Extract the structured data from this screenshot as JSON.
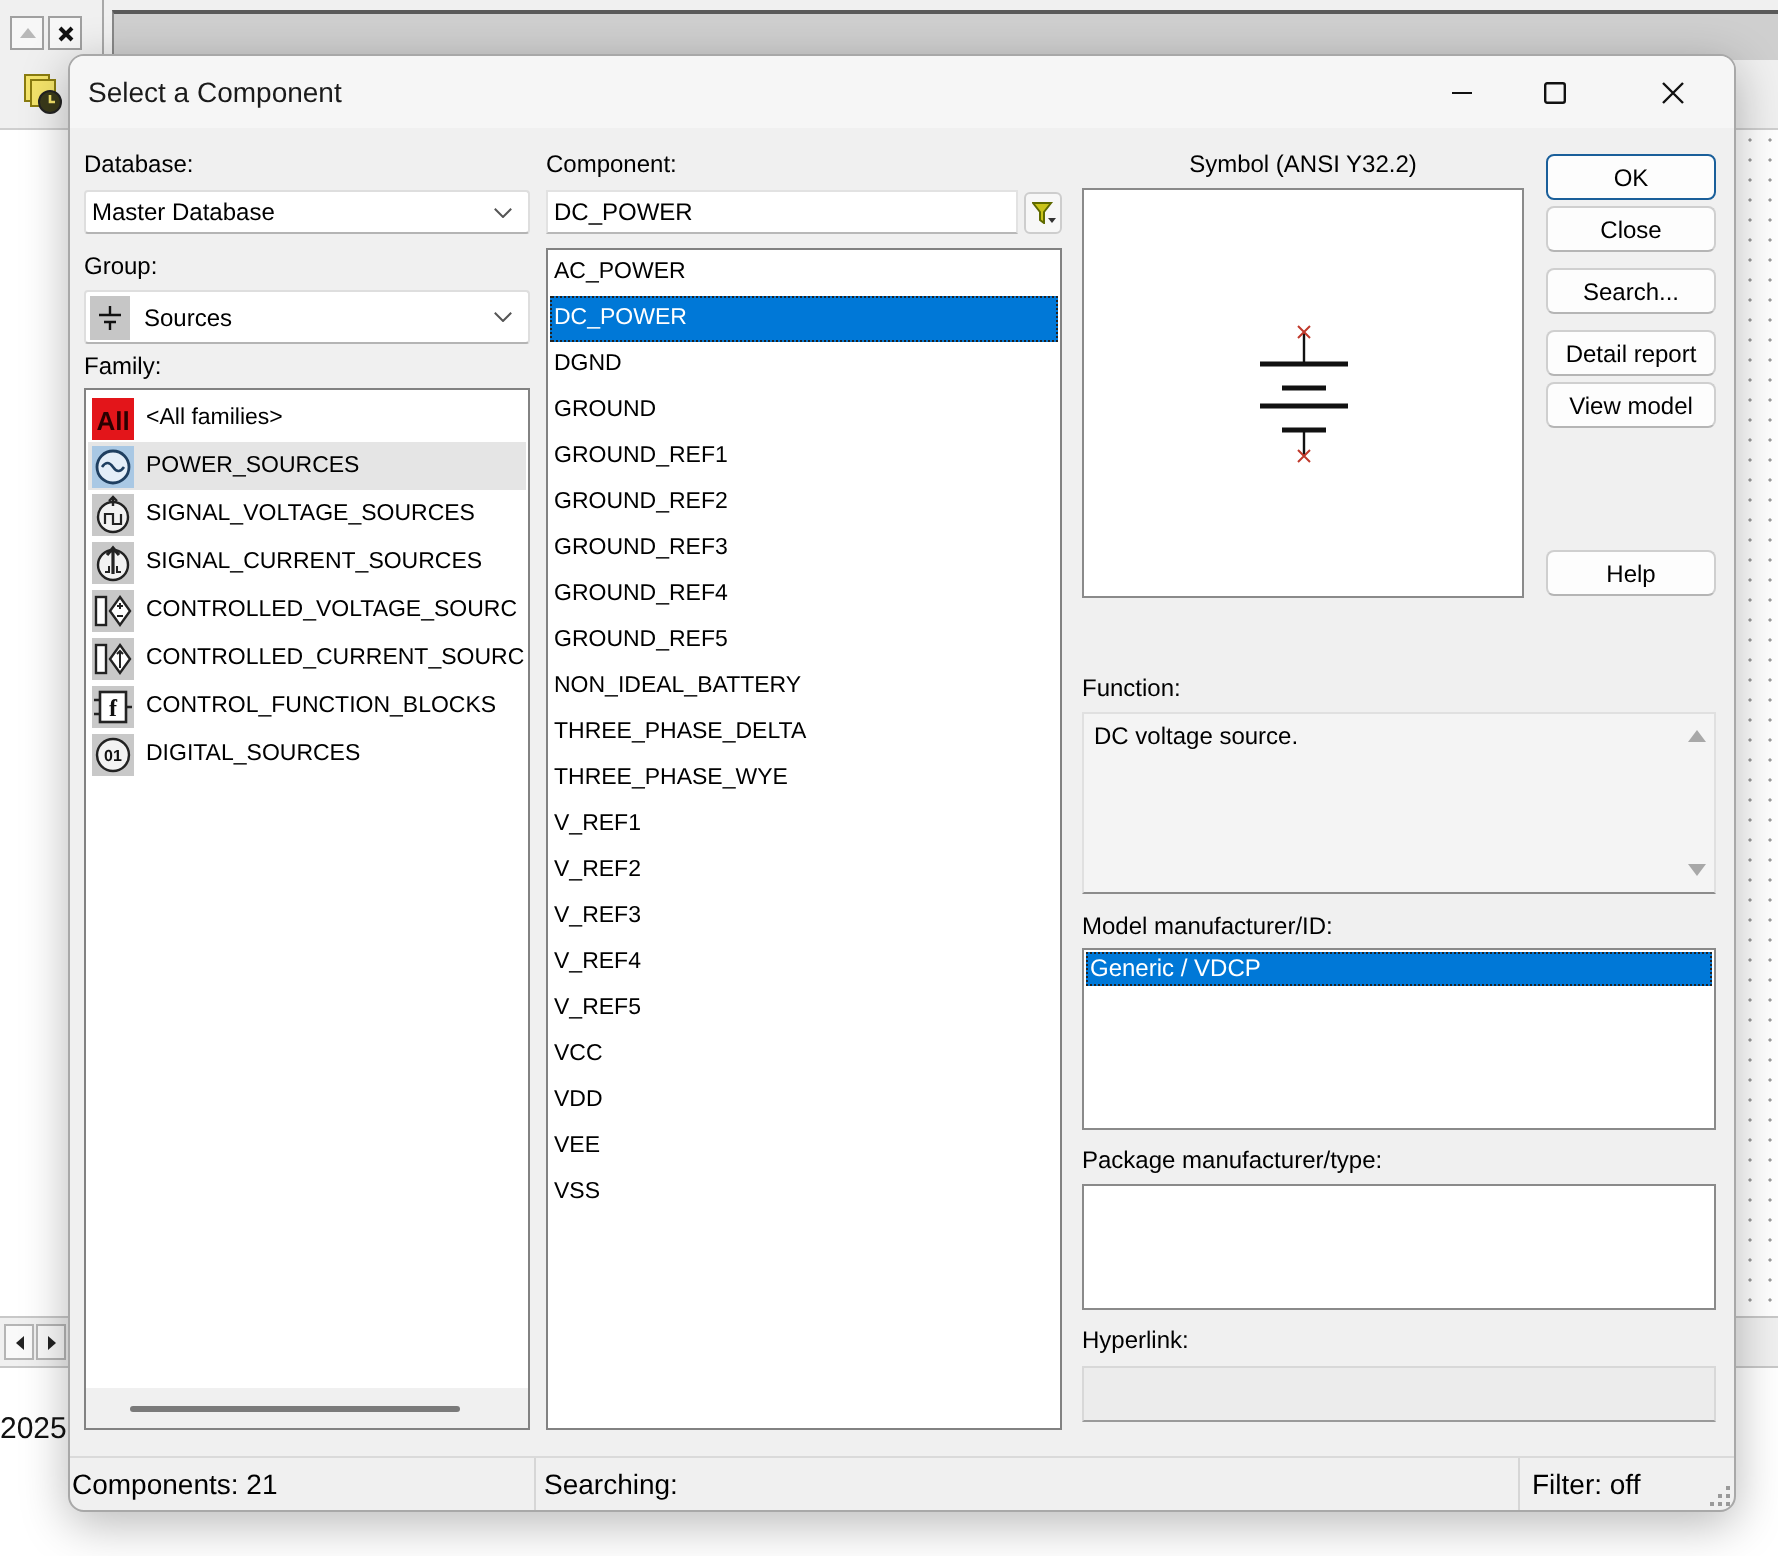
{
  "background_app": {
    "toolbar_buttons": [
      {
        "kind": "scroll_up",
        "disabled": true
      },
      {
        "kind": "close",
        "disabled": false
      }
    ],
    "scroll_buttons": [
      {
        "kind": "left"
      },
      {
        "kind": "right"
      }
    ],
    "date_text": "2025"
  },
  "window": {
    "title": "Select a Component"
  },
  "database": {
    "label": "Database:",
    "value": "Master Database"
  },
  "group": {
    "label": "Group:",
    "value": "Sources"
  },
  "family": {
    "label": "Family:",
    "items": [
      {
        "kind": "all",
        "icon_text": "All",
        "label": "<All families>",
        "selected": false
      },
      {
        "kind": "power",
        "label": "POWER_SOURCES",
        "selected": true
      },
      {
        "kind": "signal_voltage",
        "label": "SIGNAL_VOLTAGE_SOURCES",
        "selected": false
      },
      {
        "kind": "signal_current",
        "label": "SIGNAL_CURRENT_SOURCES",
        "selected": false
      },
      {
        "kind": "controlled_voltage",
        "label": "CONTROLLED_VOLTAGE_SOURC",
        "selected": false
      },
      {
        "kind": "controlled_current",
        "label": "CONTROLLED_CURRENT_SOURC",
        "selected": false
      },
      {
        "kind": "function_block",
        "icon_text": "f",
        "label": "CONTROL_FUNCTION_BLOCKS",
        "selected": false
      },
      {
        "kind": "digital",
        "icon_text": "01",
        "label": "DIGITAL_SOURCES",
        "selected": false
      }
    ]
  },
  "component": {
    "label": "Component:",
    "value": "DC_POWER",
    "items": [
      {
        "label": "AC_POWER",
        "selected": false
      },
      {
        "label": "DC_POWER",
        "selected": true
      },
      {
        "label": "DGND",
        "selected": false
      },
      {
        "label": "GROUND",
        "selected": false
      },
      {
        "label": "GROUND_REF1",
        "selected": false
      },
      {
        "label": "GROUND_REF2",
        "selected": false
      },
      {
        "label": "GROUND_REF3",
        "selected": false
      },
      {
        "label": "GROUND_REF4",
        "selected": false
      },
      {
        "label": "GROUND_REF5",
        "selected": false
      },
      {
        "label": "NON_IDEAL_BATTERY",
        "selected": false
      },
      {
        "label": "THREE_PHASE_DELTA",
        "selected": false
      },
      {
        "label": "THREE_PHASE_WYE",
        "selected": false
      },
      {
        "label": "V_REF1",
        "selected": false
      },
      {
        "label": "V_REF2",
        "selected": false
      },
      {
        "label": "V_REF3",
        "selected": false
      },
      {
        "label": "V_REF4",
        "selected": false
      },
      {
        "label": "V_REF5",
        "selected": false
      },
      {
        "label": "VCC",
        "selected": false
      },
      {
        "label": "VDD",
        "selected": false
      },
      {
        "label": "VEE",
        "selected": false
      },
      {
        "label": "VSS",
        "selected": false
      }
    ]
  },
  "symbol": {
    "title": "Symbol (ANSI Y32.2)"
  },
  "button_groups": [
    [
      {
        "label": "OK",
        "default": true
      },
      {
        "label": "Close",
        "default": false
      }
    ],
    [
      {
        "label": "Search...",
        "default": false
      }
    ],
    [
      {
        "label": "Detail report",
        "default": false
      },
      {
        "label": "View model",
        "default": false
      }
    ],
    [
      {
        "label": "Help",
        "default": false
      }
    ]
  ],
  "function": {
    "label": "Function:",
    "text": "DC voltage source."
  },
  "model": {
    "label": "Model manufacturer/ID:",
    "items": [
      {
        "label": "Generic / VDCP",
        "selected": true
      }
    ]
  },
  "package": {
    "label": "Package manufacturer/type:"
  },
  "hyperlink": {
    "label": "Hyperlink:",
    "disabled": true
  },
  "status_bar": {
    "components": "Components: 21",
    "searching": "Searching:",
    "filter": "Filter: off"
  }
}
